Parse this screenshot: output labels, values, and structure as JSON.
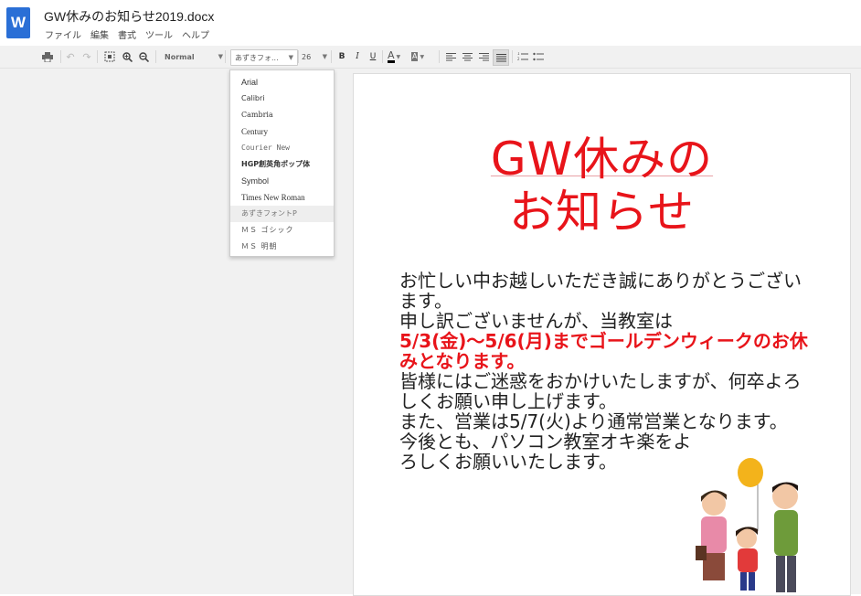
{
  "app": {
    "logo_letter": "W",
    "title": "GW休みのお知らせ2019.docx"
  },
  "menu": [
    "ファイル",
    "編集",
    "書式",
    "ツール",
    "ヘルプ"
  ],
  "toolbar": {
    "style": "Normal",
    "font": "あずきフォ...",
    "size": "26",
    "bold": "B",
    "italic": "I",
    "underline": "U",
    "text_color": "A",
    "highlight": "A"
  },
  "font_menu": [
    "Arial",
    "Calibri",
    "Cambria",
    "Century",
    "Courier New",
    "HGP創英角ポップ体",
    "Symbol",
    "Times New Roman",
    "あずきフォントP",
    "ＭＳ ゴシック",
    "ＭＳ 明朝"
  ],
  "document": {
    "heading_line1": "GW休みの",
    "heading_line2": "お知らせ",
    "para1": "お忙しい中お越しいただき誠にありがとうございます。",
    "para2": "申し訳ございませんが、当教室は",
    "para3": "5/3(金)～5/6(月)までゴールデンウィークのお休みとなります。",
    "para4": "皆様にはご迷惑をおかけいたしますが、何卒よろしくお願い申し上げます。",
    "para5": "また、営業は5/7(火)より通常営業となります。",
    "para6": "今後とも、パソコン教室オキ楽をよろしくお願いいたします。"
  },
  "colors": {
    "heading": "#e8141a",
    "emphasis": "#e8141a",
    "logo": "#2a6fd6"
  }
}
